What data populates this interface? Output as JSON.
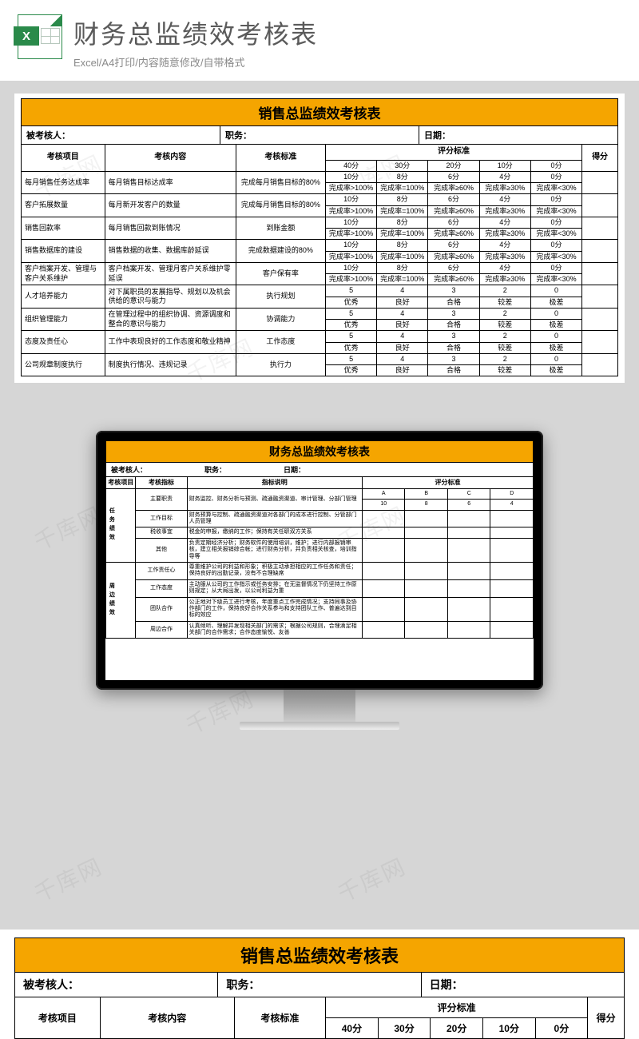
{
  "header": {
    "title": "财务总监绩效考核表",
    "subtitle": "Excel/A4打印/内容随意修改/自带格式"
  },
  "sheet1": {
    "title": "销售总监绩效考核表",
    "meta": {
      "p1": "被考核人：",
      "p2": "职务：",
      "p3": "日期："
    },
    "cols": {
      "c1": "考核项目",
      "c2": "考核内容",
      "c3": "考核标准",
      "c4": "评分标准",
      "c5": "得分"
    },
    "scoreHdr": [
      "40分",
      "30分",
      "20分",
      "10分",
      "0分"
    ],
    "prRow": [
      "完成率>100%",
      "完成率=100%",
      "完成率≥60%",
      "完成率≥30%",
      "完成率<30%"
    ],
    "scoreHdr2": [
      "10分",
      "8分",
      "6分",
      "4分",
      "0分"
    ],
    "qRow": [
      "优秀",
      "良好",
      "合格",
      "较差",
      "极差"
    ],
    "scoreHdr3": [
      "5",
      "4",
      "3",
      "2",
      "0"
    ],
    "rows": [
      {
        "a": "每月销售任务达成率",
        "b": "每月销售目标达成率",
        "c": "完成每月销售目标的80%"
      },
      {
        "a": "客户拓展数量",
        "b": "每月新开发客户的数量",
        "c": "完成每月销售目标的80%"
      },
      {
        "a": "销售回款率",
        "b": "每月销售回款到账情况",
        "c": "到账金额"
      },
      {
        "a": "销售数据库的建设",
        "b": "销售数据的收集、数据库龄延误",
        "c": "完成数据建设的80%"
      },
      {
        "a": "客户档案开发、管理与客户关系维护",
        "b": "客户档案开发、管理月客户关系维护零延误",
        "c": "客户保有率"
      },
      {
        "a": "人才培养能力",
        "b": "对下属职员的发展指导、规划以及机会供给的意识与能力",
        "c": "执行规划"
      },
      {
        "a": "组织管理能力",
        "b": "在管理过程中的组织协调、资源调度和整合的意识与能力",
        "c": "协调能力"
      },
      {
        "a": "态度及责任心",
        "b": "工作中表现良好的工作态度和敬业精神",
        "c": "工作态度"
      },
      {
        "a": "公司规章制度执行",
        "b": "制度执行情况、违规记录",
        "c": "执行力"
      }
    ]
  },
  "sheet2": {
    "title": "财务总监绩效考核表",
    "meta": {
      "p1": "被考核人：",
      "p2": "职务：",
      "p3": "日期："
    },
    "cols": {
      "c1": "考核项目",
      "c2": "考核指标",
      "c3": "指标说明",
      "c4": "评分标准"
    },
    "abcd": [
      "A",
      "B",
      "C",
      "D"
    ],
    "nums": [
      "10",
      "8",
      "6",
      "4"
    ],
    "g1": "任务绩效",
    "g2": "周边绩效",
    "rows1": [
      {
        "a": "主要职责",
        "b": "财务监控、财务分析与预测、疏通融资渠道、审计管理、分部门管理"
      },
      {
        "a": "工作目标",
        "b": "财务预算与控制、疏通融资渠道对各部门的成本进行控制、分管部门人员管理"
      },
      {
        "a": "税收事宜",
        "b": "税金的申报，缴纳的工作；保持有关任职双方关系"
      },
      {
        "a": "其他",
        "b": "负责定期经济分析；财务软件的使用培训，维护；进行内部报销审核，建立相关报销综合帐；进行财务分析，并负责相关核查，培训指导等"
      }
    ],
    "rows2": [
      {
        "a": "工作责任心",
        "b": "尊重维护公司的利益和形象；积极主动承担相应的工作任务和责任；保持良好的出勤记录，没有不合理缺席"
      },
      {
        "a": "工作态度",
        "b": "主动服从公司的工作指示或任务安排；在无监督情况下仍坚持工作原则规定；从大局出发，以公司利益为重"
      },
      {
        "a": "团队合作",
        "b": "公正地对下级员工进行考核，年度重点工作完成情况；支持同事及协作部门的工作，保持良好合作关系参与和支持团队工作、普遍达到目标的效应"
      },
      {
        "a": "周边合作",
        "b": "认真倾听、理解并发现相关部门的需求；根据公司规则，合理滴足相关部门的合作需求；合作态度愉悦、友善"
      }
    ]
  },
  "peek": {
    "title": "销售总监绩效考核表",
    "meta": {
      "p1": "被考核人：",
      "p2": "职务：",
      "p3": "日期："
    },
    "cols": {
      "c1": "考核项目",
      "c2": "考核内容",
      "c3": "考核标准",
      "c4": "评分标准",
      "c5": "得分"
    },
    "scoreHdr": [
      "40分",
      "30分",
      "20分",
      "10分",
      "0分"
    ]
  },
  "watermark": "千库网"
}
